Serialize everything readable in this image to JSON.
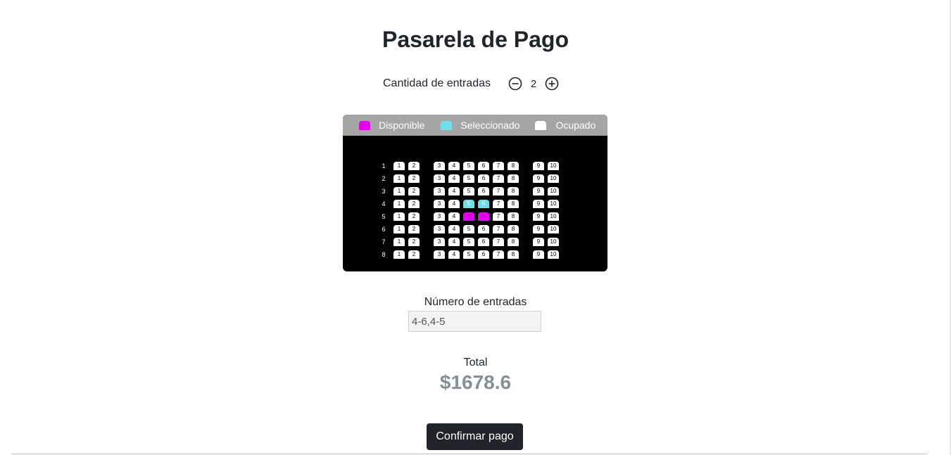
{
  "page": {
    "title": "Pasarela de Pago"
  },
  "quantity": {
    "label": "Cantidad de entradas",
    "value": "2",
    "decrement_icon": "minus-circle-icon",
    "increment_icon": "plus-circle-icon"
  },
  "legend": {
    "items": [
      {
        "label": "Disponible",
        "color": "#e600f0"
      },
      {
        "label": "Seleccionado",
        "color": "#6fe0ea"
      },
      {
        "label": "Ocupado",
        "color": "#ffffff"
      }
    ]
  },
  "seatmap": {
    "rows": [
      "1",
      "2",
      "3",
      "4",
      "5",
      "6",
      "7",
      "8"
    ],
    "seats": [
      "1",
      "2",
      "3",
      "4",
      "5",
      "6",
      "7",
      "8",
      "9",
      "10"
    ],
    "selected": [
      "4-5",
      "4-6"
    ],
    "available": [
      "5-5",
      "5-6"
    ],
    "colors": {
      "occupied": "#ffffff",
      "selected": "#6fe0ea",
      "available": "#e600f0"
    }
  },
  "entries": {
    "label": "Número de entradas",
    "value": "4-6,4-5"
  },
  "total": {
    "label": "Total",
    "value": "$1678.6"
  },
  "confirm": {
    "label": "Confirmar pago"
  }
}
